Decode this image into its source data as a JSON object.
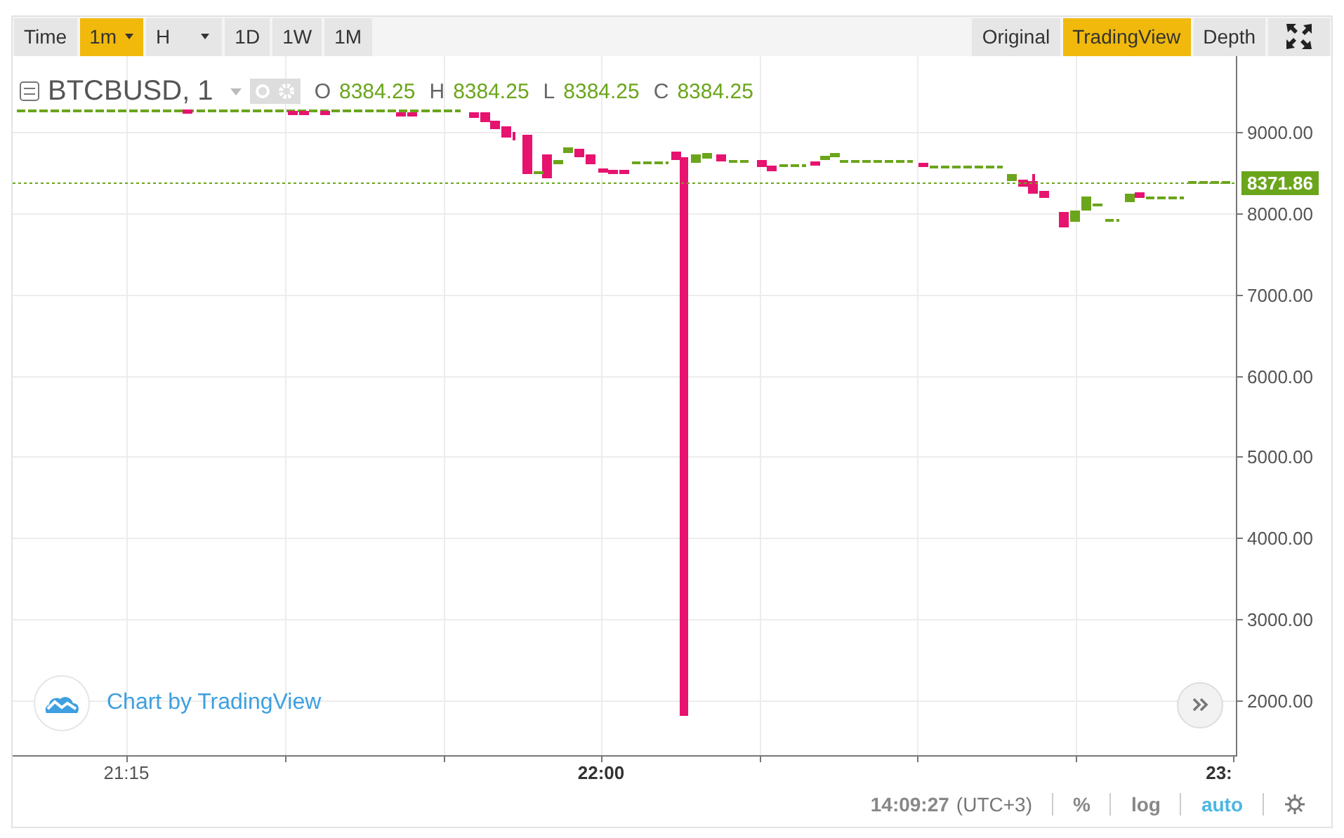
{
  "toolbar": {
    "label": "Time",
    "intervals": [
      {
        "label": "1m",
        "selected": true,
        "dropdown": true
      },
      {
        "label": "H",
        "selected": false,
        "dropdown": true
      },
      {
        "label": "1D",
        "selected": false,
        "dropdown": false
      },
      {
        "label": "1W",
        "selected": false,
        "dropdown": false
      },
      {
        "label": "1M",
        "selected": false,
        "dropdown": false
      }
    ],
    "views": [
      {
        "label": "Original",
        "selected": false
      },
      {
        "label": "TradingView",
        "selected": true
      },
      {
        "label": "Depth",
        "selected": false
      }
    ]
  },
  "chart": {
    "symbol": "BTCBUSD, 1",
    "ohlc": [
      {
        "key": "O",
        "value": "8384.25"
      },
      {
        "key": "H",
        "value": "8384.25"
      },
      {
        "key": "L",
        "value": "8384.25"
      },
      {
        "key": "C",
        "value": "8384.25"
      }
    ],
    "price_labels": [
      "9000.00",
      "8000.00",
      "7000.00",
      "6000.00",
      "5000.00",
      "4000.00",
      "3000.00",
      "2000.00"
    ],
    "last_price": "8371.86",
    "time_labels": [
      {
        "label": "21:15",
        "bold": false
      },
      {
        "label": "22:00",
        "bold": true
      },
      {
        "label": "23:",
        "bold": true
      }
    ],
    "attribution": "Chart by TradingView"
  },
  "status_bar": {
    "time": "14:09:27",
    "timezone": "(UTC+3)",
    "options": [
      {
        "label": "%",
        "selected": false
      },
      {
        "label": "log",
        "selected": false
      },
      {
        "label": "auto",
        "selected": true
      }
    ]
  }
}
